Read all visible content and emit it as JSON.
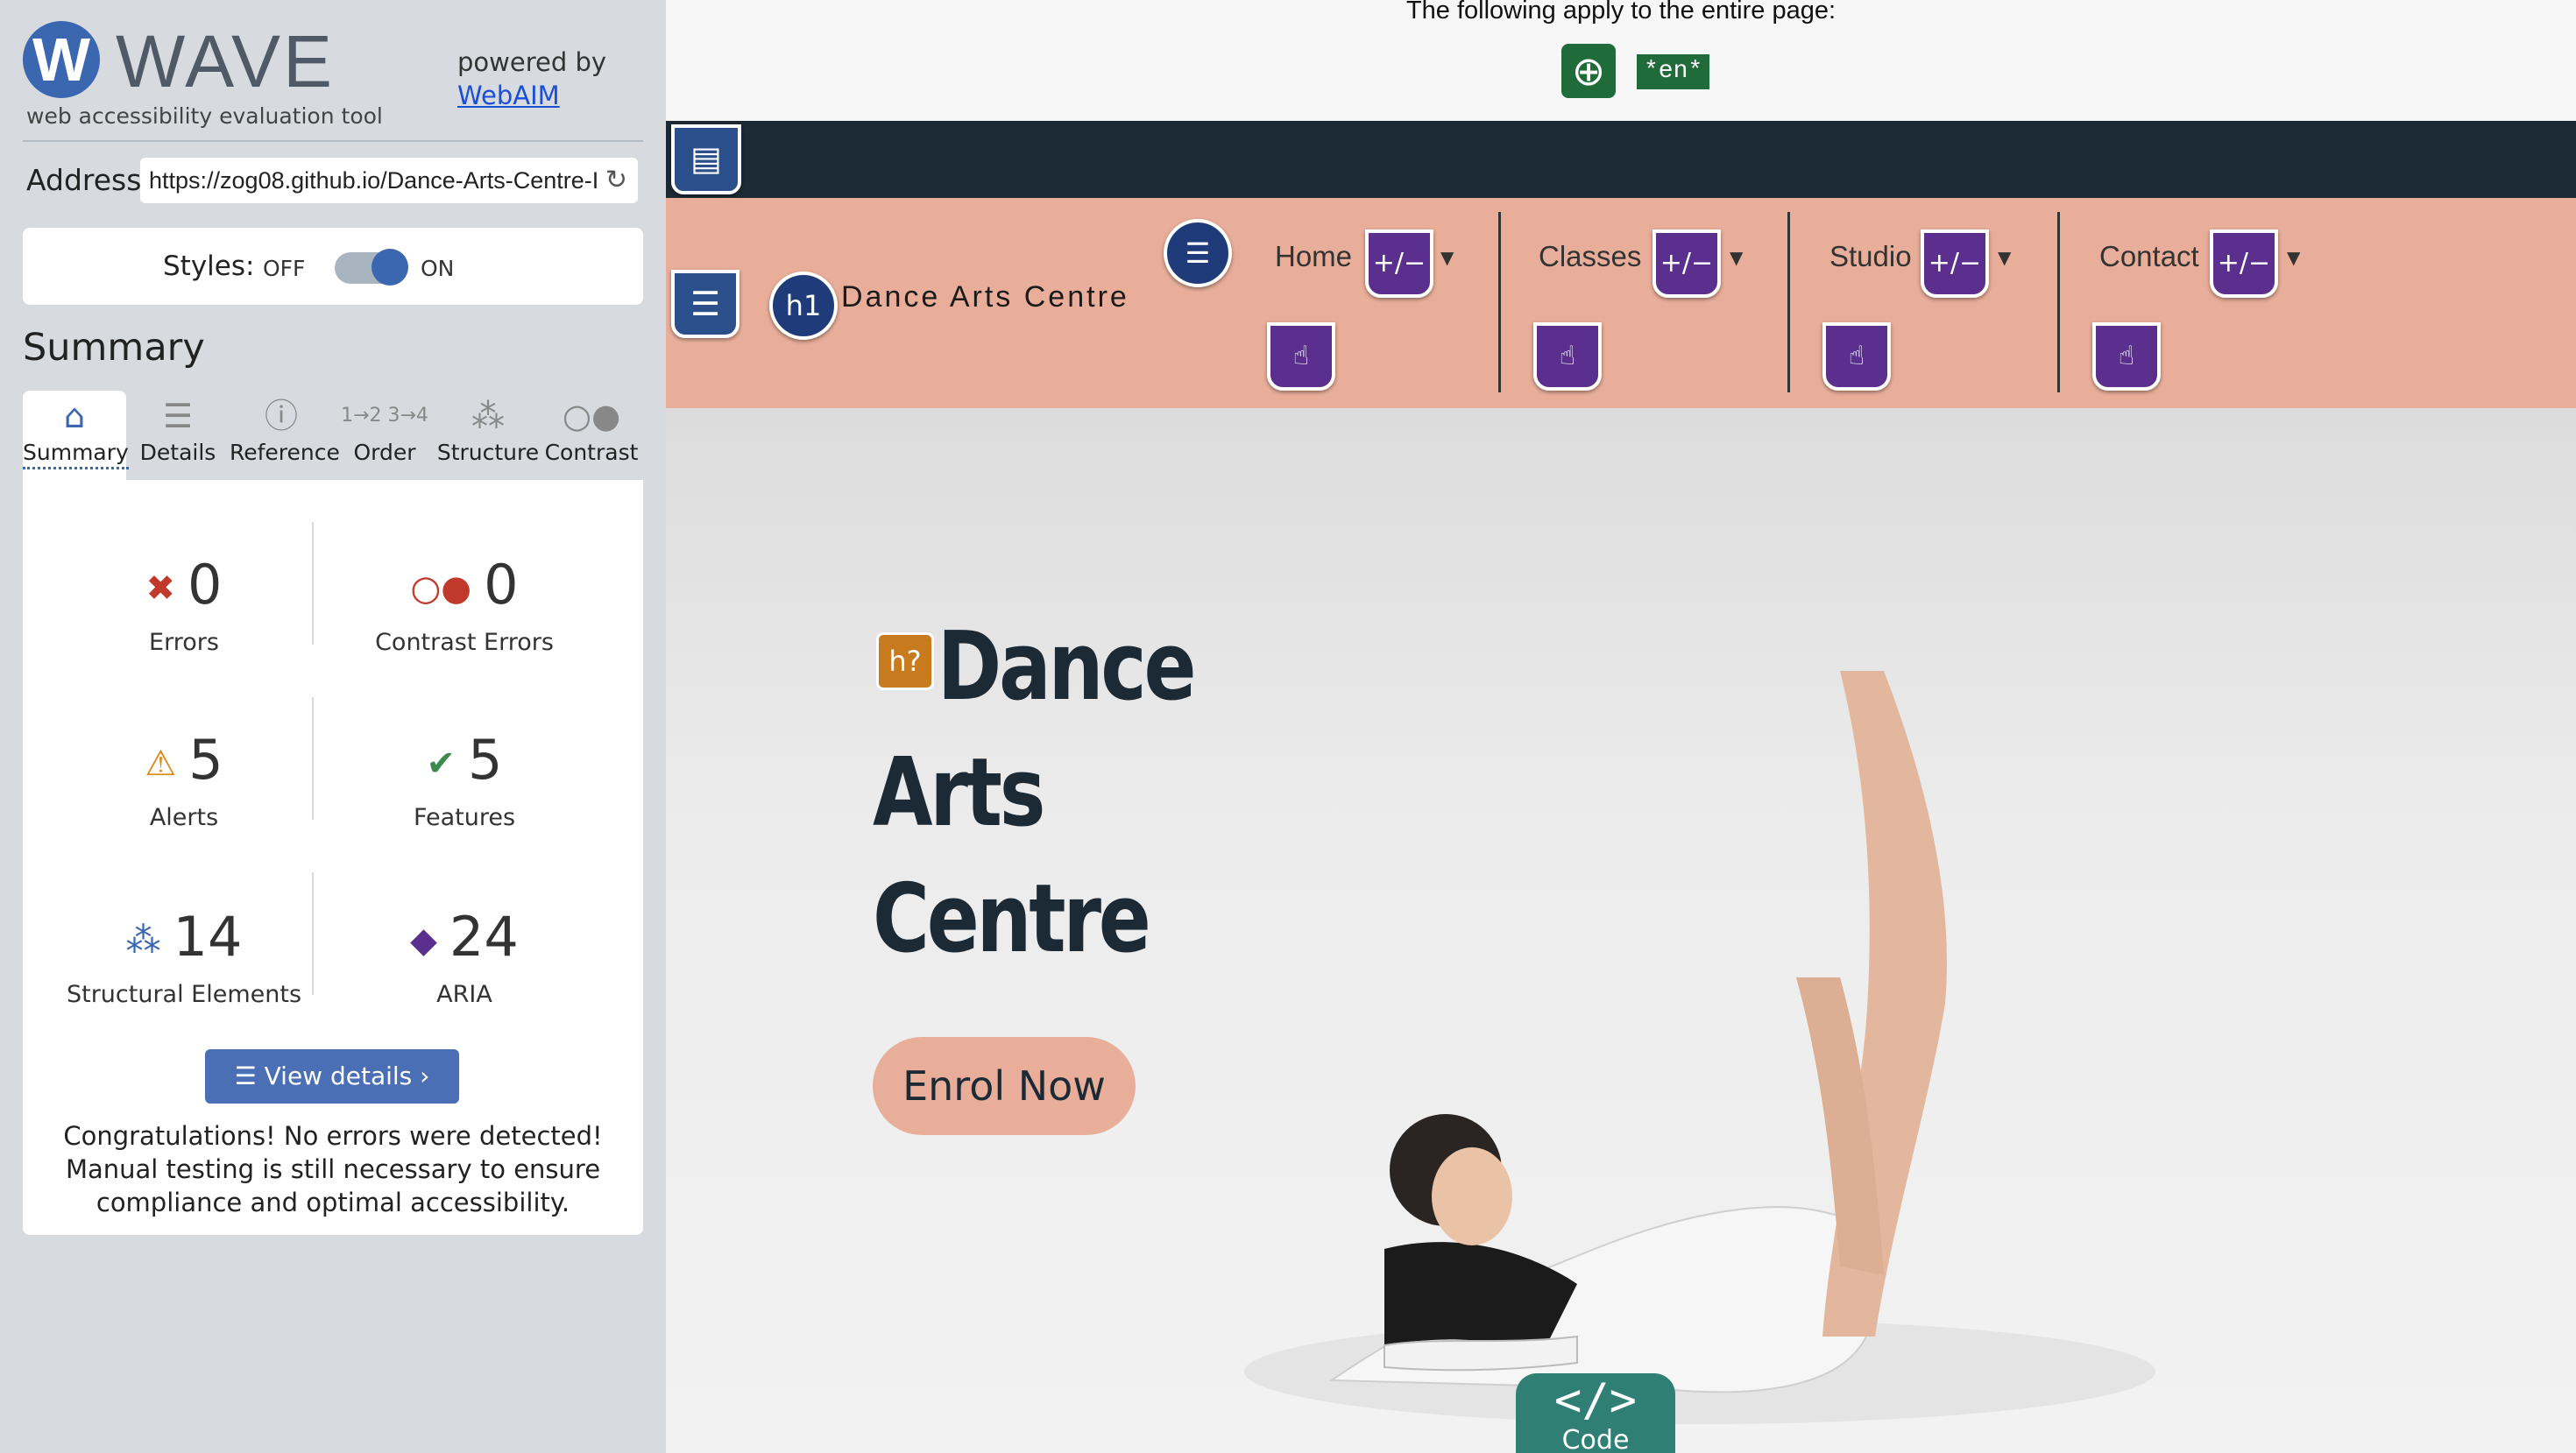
{
  "sidebar": {
    "logo_letter": "W",
    "title": "WAVE",
    "subtitle": "web accessibility evaluation tool",
    "powered_by": "powered by",
    "webaim_link": "WebAIM",
    "address_label": "Address:",
    "address_value": "https://zog08.github.io/Dance-Arts-Centre-I",
    "styles_label": "Styles:",
    "styles_off": "OFF",
    "styles_on": "ON",
    "summary_heading": "Summary",
    "tabs": [
      {
        "label": "Summary",
        "icon": "home-icon"
      },
      {
        "label": "Details",
        "icon": "list-icon"
      },
      {
        "label": "Reference",
        "icon": "info-icon"
      },
      {
        "label": "Order",
        "icon": "order-icon"
      },
      {
        "label": "Structure",
        "icon": "structure-icon"
      },
      {
        "label": "Contrast",
        "icon": "contrast-icon"
      }
    ],
    "stats": {
      "errors": {
        "value": "0",
        "label": "Errors"
      },
      "contrast_errors": {
        "value": "0",
        "label": "Contrast Errors"
      },
      "alerts": {
        "value": "5",
        "label": "Alerts"
      },
      "features": {
        "value": "5",
        "label": "Features"
      },
      "structural": {
        "value": "14",
        "label": "Structural Elements"
      },
      "aria": {
        "value": "24",
        "label": "ARIA"
      }
    },
    "view_details": "View details ›",
    "congrats": "Congratulations! No errors were detected! Manual testing is still necessary to ensure compliance and optimal accessibility."
  },
  "page": {
    "top_note": "The following apply to the entire page:",
    "lang_badge": "*en*",
    "site_title": "Dance Arts Centre",
    "h1_badge": "h1",
    "nav": [
      "Home",
      "Classes",
      "Studio",
      "Contact"
    ],
    "aria_plus_minus": "+/−",
    "alert_h_badge": "h?",
    "hero_title_lines": [
      "Dance",
      "Arts",
      "Centre"
    ],
    "enrol_button": "Enrol Now",
    "code_tab_symbol": "</>",
    "code_tab_label": "Code"
  },
  "colors": {
    "wave_blue": "#3a67b0",
    "nav_band": "#e9ae9a",
    "dark_bar": "#1c2a36",
    "aria_purple": "#5a2f8e",
    "error_red": "#c0392b",
    "alert_orange": "#d98a1f",
    "feature_green": "#3e8a4e",
    "code_teal": "#2f7f75"
  }
}
